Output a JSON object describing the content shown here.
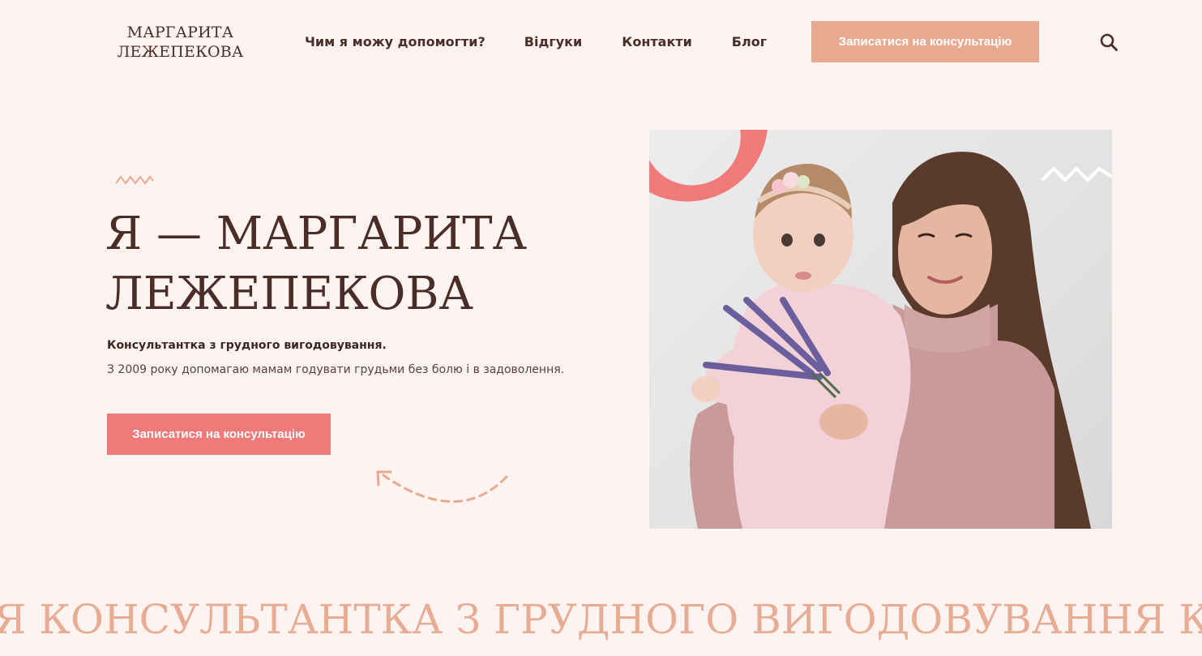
{
  "header": {
    "logo_line1": "МАРГАРИТА",
    "logo_line2": "ЛЕЖЕПЕКОВА",
    "nav": [
      {
        "label": "Чим я можу допомогти?"
      },
      {
        "label": "Відгуки"
      },
      {
        "label": "Контакти"
      },
      {
        "label": "Блог"
      }
    ],
    "cta_label": "Записатися на консультацію",
    "search_icon": "search-icon"
  },
  "hero": {
    "title_line1": "Я — МАРГАРИТА",
    "title_line2": "ЛЕЖЕПЕКОВА",
    "subtitle_strong": "Консультантка з грудного вигодовування.",
    "subtitle_text": "З 2009 року допомагаю мамам годувати грудьми без болю і в задоволення.",
    "cta_label": "Записатися на консультацію",
    "decor_icons": [
      "zigzag-icon",
      "dashed-arrow-icon"
    ]
  },
  "photo": {
    "alt": "Маргарита Лежепекова з дитиною"
  },
  "marquee": {
    "text": "Я КОНСУЛЬТАНТКА З ГРУДНОГО ВИГОДОВУВАННЯ КОНСУЛЬТАНТКА"
  },
  "colors": {
    "background": "#fdf4f1",
    "text": "#4a2d26",
    "accent_peach": "#e7a98f",
    "accent_coral": "#f07a7a",
    "marquee": "#e7ac93"
  }
}
